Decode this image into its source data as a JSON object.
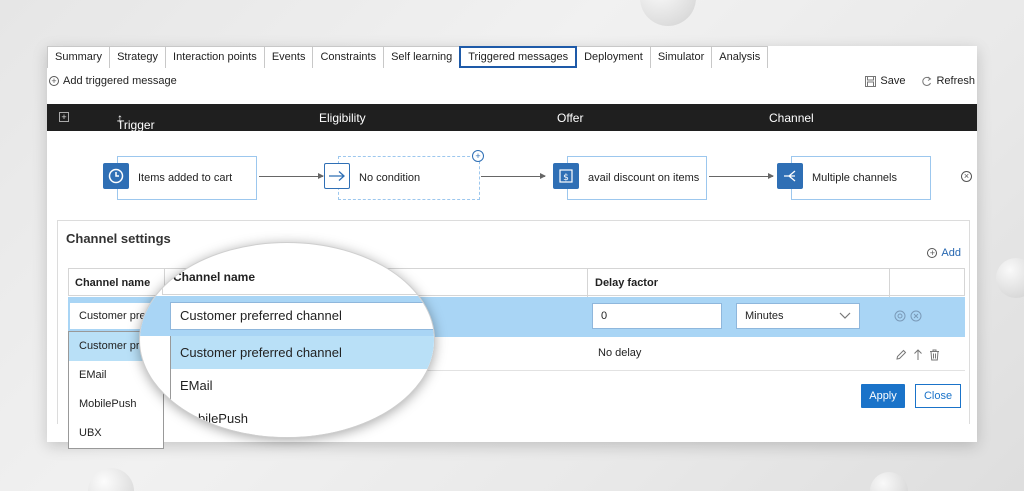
{
  "tabs": [
    "Summary",
    "Strategy",
    "Interaction points",
    "Events",
    "Constraints",
    "Self learning",
    "Triggered messages",
    "Deployment",
    "Simulator",
    "Analysis"
  ],
  "active_tab": "Triggered messages",
  "toolbar": {
    "add_label": "Add triggered message",
    "save_label": "Save",
    "refresh_label": "Refresh"
  },
  "columns": {
    "trigger": "Trigger",
    "eligibility": "Eligibility",
    "offer": "Offer",
    "channel": "Channel"
  },
  "flow": {
    "trigger": "Items added to cart",
    "eligibility": "No condition",
    "offer": "avail discount on items",
    "channel": "Multiple channels"
  },
  "settings": {
    "title": "Channel settings",
    "add_label": "Add",
    "col_channel": "Channel name",
    "col_delay": "Delay factor",
    "selected_channel": "Customer preferred channel",
    "selected_channel_short": "Customer pref",
    "delay_value": "0",
    "delay_unit": "Minutes",
    "row2_delay": "No delay",
    "options": [
      "Customer preferred channel",
      "EMail",
      "MobilePush",
      "UBX"
    ],
    "options_short": [
      "Customer pref",
      "EMail",
      "MobilePush",
      "UBX"
    ],
    "apply_label": "Apply",
    "close_label": "Close"
  },
  "colors": {
    "accent": "#1a73c9",
    "selection": "#a9d5f5",
    "header": "#1f1f1f"
  }
}
